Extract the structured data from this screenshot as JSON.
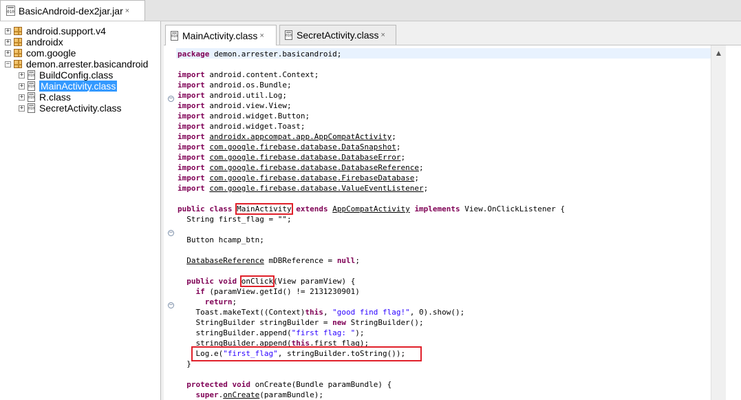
{
  "window": {
    "file_tab": {
      "icon": "jar-file-icon",
      "icon_text": "010",
      "label": "BasicAndroid-dex2jar.jar",
      "close": "×"
    }
  },
  "tree": {
    "items": [
      {
        "label": "android.support.v4",
        "expander": "+",
        "icon": "package-icon"
      },
      {
        "label": "androidx",
        "expander": "+",
        "icon": "package-icon"
      },
      {
        "label": "com.google",
        "expander": "+",
        "icon": "package-icon"
      },
      {
        "label": "demon.arrester.basicandroid",
        "expander": "−",
        "icon": "package-icon"
      },
      {
        "label": "BuildConfig.class",
        "expander": "+",
        "icon": "class-file-icon",
        "icon_text": "010"
      },
      {
        "label": "MainActivity.class",
        "expander": "+",
        "icon": "class-file-icon",
        "icon_text": "010",
        "selected": true
      },
      {
        "label": "R.class",
        "expander": "+",
        "icon": "class-file-icon",
        "icon_text": "010"
      },
      {
        "label": "SecretActivity.class",
        "expander": "+",
        "icon": "class-file-icon",
        "icon_text": "010"
      }
    ]
  },
  "editor": {
    "tabs": [
      {
        "label": "MainActivity.class",
        "icon_text": "010",
        "close": "×",
        "active": true
      },
      {
        "label": "SecretActivity.class",
        "icon_text": "010",
        "close": "×",
        "active": false
      }
    ],
    "fold_markers": {
      "collapse": "−"
    },
    "scroll_up": "▲",
    "code": {
      "package_kw": "package",
      "package_name": " demon.arrester.basicandroid;",
      "import_kw": "import",
      "imports": [
        {
          "name": "android.content.Context",
          "underline": false
        },
        {
          "name": "android.os.Bundle",
          "underline": false
        },
        {
          "name": "android.util.Log",
          "underline": false
        },
        {
          "name": "android.view.View",
          "underline": false
        },
        {
          "name": "android.widget.Button",
          "underline": false
        },
        {
          "name": "android.widget.Toast",
          "underline": false
        },
        {
          "name": "androidx.appcompat.app.AppCompatActivity",
          "underline": true
        },
        {
          "name": "com.google.firebase.database.DataSnapshot",
          "underline": true
        },
        {
          "name": "com.google.firebase.database.DatabaseError",
          "underline": true
        },
        {
          "name": "com.google.firebase.database.DatabaseReference",
          "underline": true
        },
        {
          "name": "com.google.firebase.database.FirebaseDatabase",
          "underline": true
        },
        {
          "name": "com.google.firebase.database.ValueEventListener",
          "underline": true
        }
      ],
      "class_decl": {
        "public": "public",
        "class": "class",
        "name": "MainActivity",
        "extends": "extends",
        "super": "AppCompatActivity",
        "implements": "implements",
        "iface": " View.OnClickListener {"
      },
      "field1": "  String first_flag = \"\";",
      "field2": "  Button hcamp_btn;",
      "field3_type": "DatabaseReference",
      "field3_rest": " mDBReference = ",
      "field3_null": "null",
      "field3_end": ";",
      "onclick": {
        "public": "public",
        "void": "void",
        "name": "onClick",
        "params": "(View paramView) {"
      },
      "if_kw": "if",
      "if_rest": " (paramView.getId() != 2131230901)",
      "return_kw": "return",
      "return_end": ";",
      "toast_pre": "    Toast.makeText((Context)",
      "toast_this": "this",
      "toast_mid": ", ",
      "toast_str": "\"good find flag!\"",
      "toast_end": ", 0).show();",
      "sb_pre": "    StringBuilder stringBuilder = ",
      "sb_new": "new",
      "sb_end": " StringBuilder();",
      "append1_pre": "    stringBuilder.append(",
      "append1_str": "\"first flag: \"",
      "append1_end": ");",
      "append2_pre": "    stringBuilder.append(",
      "append2_this": "this",
      "append2_end": ".first_flag);",
      "log_pre": "    Log.e(",
      "log_str": "\"first_flag\"",
      "log_end": ", stringBuilder.toString());",
      "close_brace": "  }",
      "oncreate": {
        "protected": "protected",
        "void": "void",
        "rest": " onCreate(Bundle paramBundle) {"
      },
      "super_kw": "super",
      "super_dot": ".",
      "super_call": "onCreate",
      "super_end": "(paramBundle);"
    }
  }
}
